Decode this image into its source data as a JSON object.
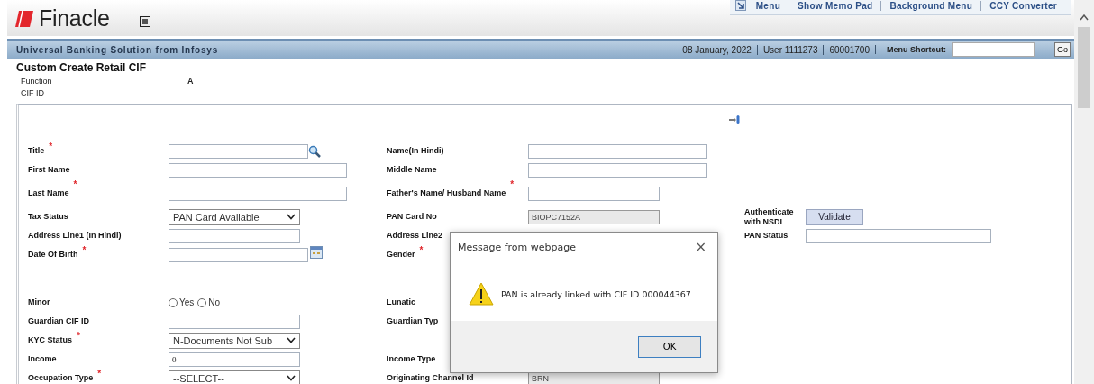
{
  "header": {
    "logo": "Finacle",
    "links": [
      "Menu",
      "Show Memo Pad",
      "Background Menu",
      "CCY Converter"
    ]
  },
  "banner": {
    "title": "Universal Banking Solution from Infosys",
    "date": "08 January, 2022",
    "user": "User  1111273",
    "branch": "60001700",
    "shortcut_label": "Menu Shortcut:",
    "go": "Go"
  },
  "page": {
    "title": "Custom Create Retail CIF",
    "info": [
      {
        "label": "Function",
        "value": "A"
      },
      {
        "label": "CIF ID"
      }
    ]
  },
  "form_rows": [
    {
      "kind": "row",
      "cells": [
        {
          "label": "Title",
          "required_mark": "*",
          "control": {
            "kind": "lookup"
          }
        },
        {
          "label": "Name(In Hindi)",
          "control": {
            "kind": "longtext"
          }
        }
      ]
    },
    {
      "kind": "row",
      "cells": [
        {
          "label": "First Name",
          "control": {
            "kind": "longtext"
          }
        },
        {
          "label": "Middle Name",
          "control": {
            "kind": "longtext"
          }
        }
      ]
    },
    {
      "kind": "tall",
      "cells": [
        {
          "label": "Last Name",
          "required_mark": "*",
          "control": {
            "kind": "longtext"
          }
        },
        {
          "label": "Father's Name/ Husband Name",
          "required_mark": "*",
          "control": {
            "kind": "text"
          }
        }
      ]
    },
    {
      "kind": "row",
      "cells": [
        {
          "label": "Tax Status",
          "control": {
            "kind": "select",
            "value": "PAN Card Available"
          }
        },
        {
          "label": "PAN Card No",
          "control": {
            "kind": "text",
            "value": "BIOPC7152A",
            "disabled": true
          }
        },
        {
          "label": "Authenticate with NSDL",
          "control": {
            "kind": "button",
            "value": "Validate"
          }
        }
      ]
    },
    {
      "kind": "row",
      "cells": [
        {
          "label": "Address Line1 (In Hindi)",
          "control": {
            "kind": "text"
          }
        },
        {
          "label": "Address Line2"
        },
        {
          "label": "PAN Status",
          "control": {
            "kind": "longtext"
          }
        }
      ]
    },
    {
      "kind": "row",
      "cells": [
        {
          "label": "Date Of Birth",
          "required_mark": "*",
          "control": {
            "kind": "date"
          }
        },
        {
          "label": "Gender",
          "required_mark": "*"
        }
      ]
    },
    {
      "kind": "gap",
      "cells": []
    },
    {
      "kind": "row",
      "cells": [
        {
          "label": "Minor",
          "control": {
            "kind": "radio",
            "options": [
              {
                "label": "Yes",
                "selected": false
              },
              {
                "label": "No",
                "selected": false
              }
            ]
          }
        },
        {
          "label": "Lunatic"
        }
      ]
    },
    {
      "kind": "row",
      "cells": [
        {
          "label": "Guardian CIF ID",
          "control": {
            "kind": "text"
          }
        },
        {
          "label": "Guardian Typ"
        }
      ]
    },
    {
      "kind": "row",
      "cells": [
        {
          "label": "KYC Status",
          "required_mark": "*",
          "control": {
            "kind": "select",
            "value": "N-Documents Not Sub"
          }
        }
      ]
    },
    {
      "kind": "row",
      "cells": [
        {
          "label": "Income",
          "control": {
            "kind": "text",
            "value": "0"
          }
        },
        {
          "label": "Income Type"
        }
      ]
    },
    {
      "kind": "row",
      "cells": [
        {
          "label": "Occupation Type",
          "required_mark": "*",
          "control": {
            "kind": "select",
            "value": "--SELECT--"
          }
        },
        {
          "label": "Originating Channel Id",
          "control": {
            "kind": "text",
            "value": "BRN",
            "disabled": true
          }
        }
      ]
    }
  ],
  "dialog": {
    "title": "Message from webpage",
    "close": "×",
    "message": "PAN is already linked with CIF ID 000044367",
    "ok": "OK"
  }
}
